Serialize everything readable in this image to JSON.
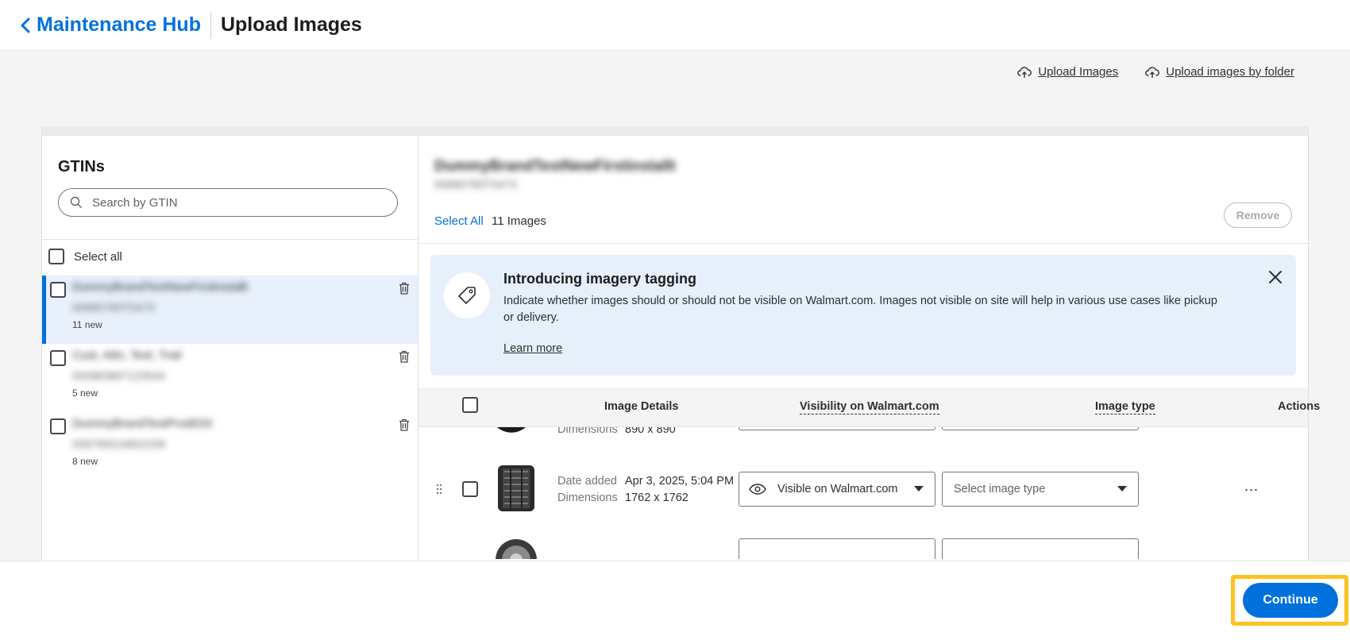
{
  "header": {
    "back_label": "Maintenance Hub",
    "title": "Upload Images"
  },
  "upload_links": {
    "upload_images": "Upload Images",
    "upload_by_folder": "Upload images by folder"
  },
  "gtins": {
    "title": "GTINs",
    "search_placeholder": "Search by GTIN",
    "select_all": "Select all",
    "items": [
      {
        "name": "DummyBrandTestNewFirstinstallt",
        "code": "00685765TS473",
        "new_count": "11 new"
      },
      {
        "name": "Cust, Attn, Test, Trail",
        "code": "000983667123544",
        "new_count": "5 new"
      },
      {
        "name": "DummyBrandTestProd033",
        "code": "006795019602208",
        "new_count": "8 new"
      }
    ]
  },
  "product": {
    "name": "DummyBrandTestNewFirstinstallt",
    "code": "00685765TS473",
    "select_all": "Select All",
    "image_count": "11 Images",
    "remove_label": "Remove"
  },
  "banner": {
    "title": "Introducing imagery tagging",
    "text": "Indicate whether images should or should not be visible on Walmart.com. Images not visible on site will help in various use cases like pickup or delivery.",
    "link": "Learn more"
  },
  "table": {
    "columns": {
      "image_details": "Image Details",
      "visibility": "Visibility on Walmart.com",
      "image_type": "Image type",
      "actions": "Actions"
    },
    "rows": [
      {
        "dimensions_label": "Dimensions",
        "dimensions": "890 x 890"
      },
      {
        "date_label": "Date added",
        "date": "Apr 3, 2025, 5:04 PM",
        "dimensions_label": "Dimensions",
        "dimensions": "1762 x 1762",
        "visibility": "Visible on Walmart.com",
        "image_type_placeholder": "Select image type",
        "actions": "..."
      }
    ]
  },
  "footer": {
    "continue_label": "Continue"
  },
  "colors": {
    "brand_blue": "#0071dc",
    "highlight": "#ffc220",
    "banner_bg": "#e6f0fb"
  }
}
